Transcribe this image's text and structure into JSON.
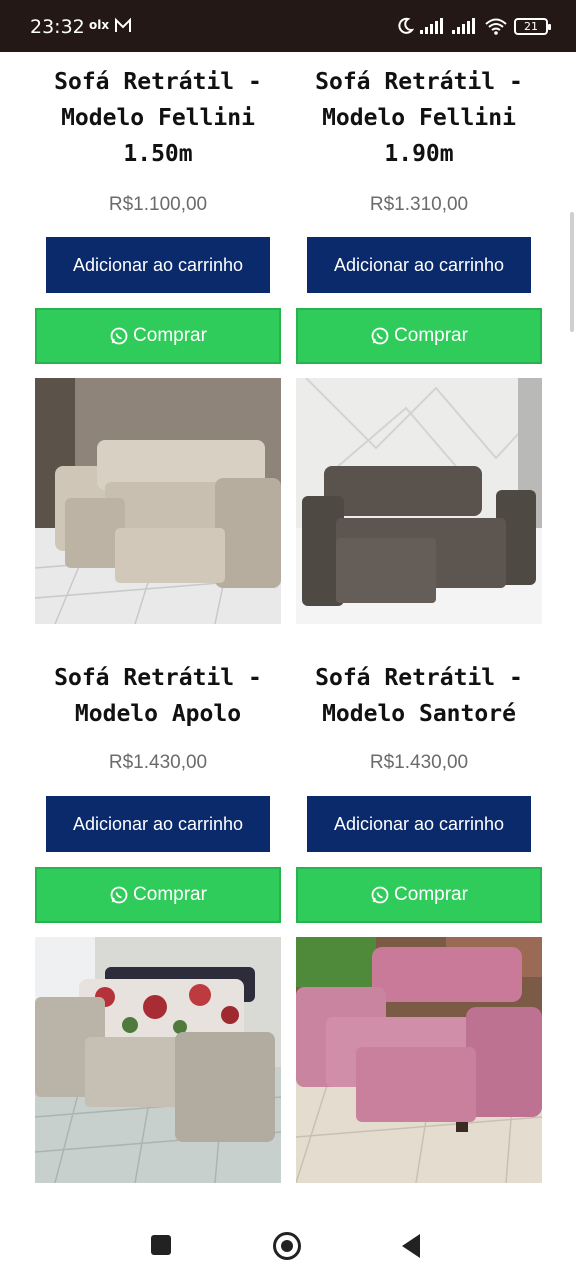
{
  "status_bar": {
    "time": "23:32",
    "olx_label": "olx",
    "battery": "21"
  },
  "products": [
    {
      "title": "Sofá Retrátil - Modelo Fellini 1.50m",
      "price": "R$1.100,00",
      "cart_label": "Adicionar ao carrinho",
      "buy_label": "Comprar"
    },
    {
      "title": "Sofá Retrátil - Modelo Fellini 1.90m",
      "price": "R$1.310,00",
      "cart_label": "Adicionar ao carrinho",
      "buy_label": "Comprar"
    },
    {
      "title": "Sofá Retrátil - Modelo Apolo",
      "price": "R$1.430,00",
      "cart_label": "Adicionar ao carrinho",
      "buy_label": "Comprar"
    },
    {
      "title": "Sofá Retrátil - Modelo Santoré",
      "price": "R$1.430,00",
      "cart_label": "Adicionar ao carrinho",
      "buy_label": "Comprar"
    }
  ],
  "images": [
    {
      "name": "sofa-beige-photo"
    },
    {
      "name": "sofa-grey-photo"
    },
    {
      "name": "sofa-floral-photo"
    },
    {
      "name": "sofa-pink-photo"
    }
  ],
  "colors": {
    "cart_button": "#0a2a6c",
    "buy_button": "#2fcc5b",
    "status_bar": "#231815"
  }
}
